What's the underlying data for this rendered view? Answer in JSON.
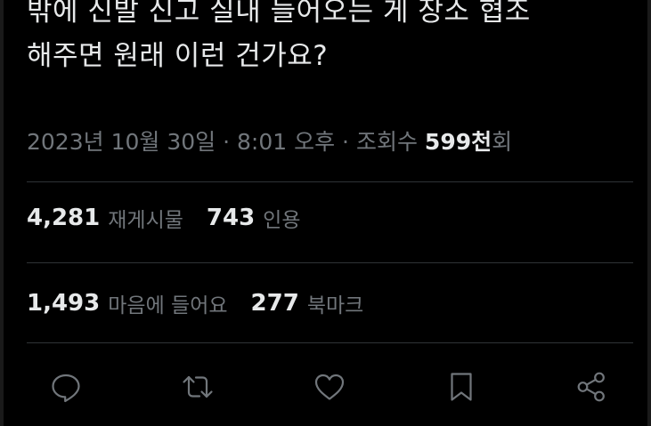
{
  "tweet": {
    "lines": [
      "밖에 신발 신고 실내 들어오는 게 장소 협조",
      "해주면 원래 이런 건가요?"
    ]
  },
  "meta": {
    "date": "2023년 10월 30일",
    "separator": "·",
    "time": "8:01 오후",
    "views_label": "조회수",
    "views_count": "599천",
    "views_suffix": "회"
  },
  "stats": {
    "reposts_value": "4,281",
    "reposts_label": "재게시물",
    "quotes_value": "743",
    "quotes_label": "인용",
    "likes_value": "1,493",
    "likes_label": "마음에 들어요",
    "bookmarks_value": "277",
    "bookmarks_label": "북마크"
  },
  "actions": [
    {
      "icon": "reply-icon"
    },
    {
      "icon": "repost-icon"
    },
    {
      "icon": "like-icon"
    },
    {
      "icon": "bookmark-icon"
    },
    {
      "icon": "share-icon"
    }
  ],
  "colors": {
    "background": "#000000",
    "text_primary": "#e7e9ea",
    "text_secondary": "#71767b",
    "divider": "#2f3336"
  }
}
